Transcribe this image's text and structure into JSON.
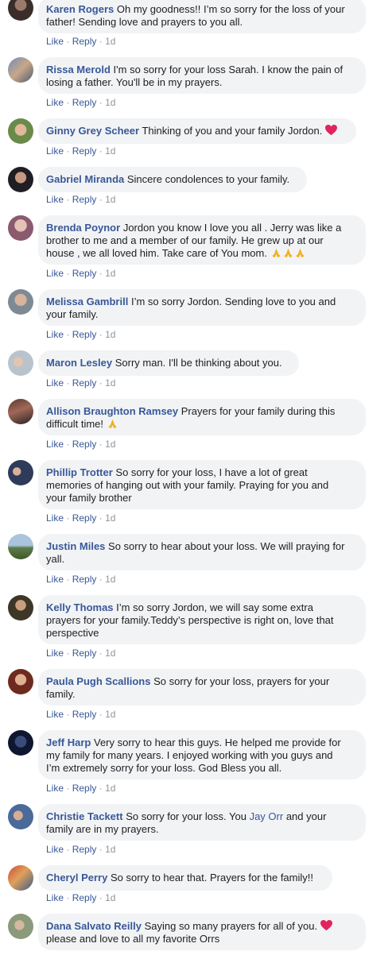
{
  "actions": {
    "like": "Like",
    "reply": "Reply",
    "sep": "·",
    "time": "1d"
  },
  "comments": [
    {
      "name": "Karen Rogers",
      "line1": "Oh my goodness!! I’m so sorry for the loss of your",
      "line2": "father! Sending love and prayers to you all."
    },
    {
      "name": "Rissa Merold",
      "line1": "I'm so sorry for your loss Sarah. I know the pain of",
      "line2": "losing a father. You'll be in my prayers."
    },
    {
      "name": "Ginny Grey Scheer",
      "line1": "Thinking of you and your family Jordon."
    },
    {
      "name": "Gabriel Miranda",
      "line1": "Sincere condolences to your family."
    },
    {
      "name": "Brenda Poynor",
      "line1": "Jordon you know I love you all . Jerry was like a",
      "line2": "brother to me and a member of our family. He grew up at our",
      "line3": "house , we all loved him. Take care of You mom."
    },
    {
      "name": "Melissa Gambrill",
      "line1": "I’m so sorry Jordon. Sending love to you and",
      "line2": "your family."
    },
    {
      "name": "Maron Lesley",
      "line1": "Sorry man. I'll be thinking about you."
    },
    {
      "name": "Allison Braughton Ramsey",
      "line1": "Prayers for your family during this",
      "line2": "difficult time!"
    },
    {
      "name": "Phillip Trotter",
      "line1": "So sorry for your loss, I have a lot of great",
      "line2": "memories of hanging out with your family. Praying for you and",
      "line3": "your family brother"
    },
    {
      "name": "Justin Miles",
      "line1": "So sorry to hear about your loss. We will praying for",
      "line2": "yall."
    },
    {
      "name": "Kelly Thomas",
      "line1": "I’m so sorry Jordon, we will say some extra",
      "line2": "prayers for your family.Teddy’s perspective is right on, love that",
      "line3": "perspective"
    },
    {
      "name": "Paula Pugh Scallions",
      "line1": "So sorry for your loss, prayers for your",
      "line2": "family."
    },
    {
      "name": "Jeff Harp",
      "line1": "Very sorry to hear this guys. He helped me provide for",
      "line2": "my family for many years. I enjoyed working with you guys and",
      "line3": "I’m extremely sorry for your loss. God Bless you all."
    },
    {
      "name": "Christie Tackett",
      "line1a": "So sorry for your loss. You",
      "mention": "Jay Orr",
      "line1b": "and your",
      "line2": "family are in my prayers."
    },
    {
      "name": "Cheryl Perry",
      "line1": "So sorry to hear that. Prayers for the family!!"
    },
    {
      "name": "Dana Salvato Reilly",
      "line1": "Saying so many prayers for all of you.",
      "line2": "please and love to all my favorite Orrs"
    }
  ]
}
